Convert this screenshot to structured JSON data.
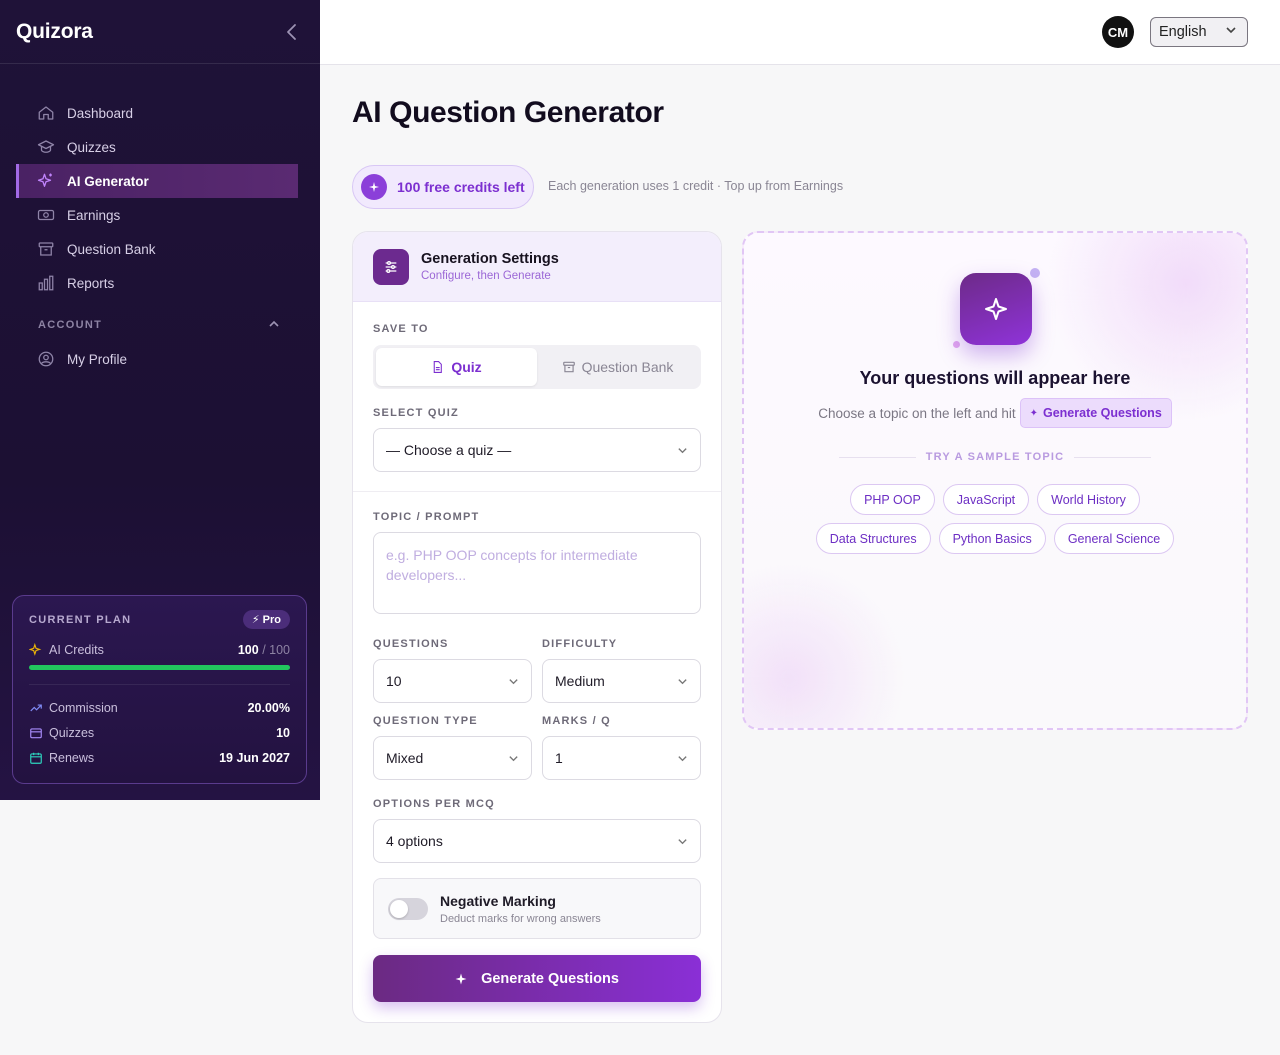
{
  "app": {
    "brand": "Quizora"
  },
  "sidebar": {
    "items": [
      {
        "label": "Dashboard",
        "icon": "home-icon"
      },
      {
        "label": "Quizzes",
        "icon": "graduation-cap-icon"
      },
      {
        "label": "AI Generator",
        "icon": "sparkles-icon",
        "active": true
      },
      {
        "label": "Earnings",
        "icon": "banknote-icon"
      },
      {
        "label": "Question Bank",
        "icon": "archive-icon"
      },
      {
        "label": "Reports",
        "icon": "bar-chart-icon"
      }
    ],
    "account_section": "ACCOUNT",
    "account_items": [
      {
        "label": "My Profile",
        "icon": "user-circle-icon"
      }
    ],
    "plan": {
      "title": "CURRENT PLAN",
      "badge": "Pro",
      "credits_label": "AI Credits",
      "credits_used": "100",
      "credits_total": "/ 100",
      "credits_fraction": 1.0,
      "commission_label": "Commission",
      "commission_value": "20.00%",
      "quizzes_label": "Quizzes",
      "quizzes_value": "10",
      "renews_label": "Renews",
      "renews_value": "19 Jun 2027"
    }
  },
  "topbar": {
    "avatar_initials": "CM",
    "language": "English"
  },
  "main": {
    "title": "AI Question Generator",
    "credits_pill": "100 free credits left",
    "credits_note": "Each generation uses 1 credit · Top up from Earnings"
  },
  "settings": {
    "title": "Generation Settings",
    "subtitle": "Configure, then Generate",
    "save_to_label": "SAVE TO",
    "save_to_options": [
      "Quiz",
      "Question Bank"
    ],
    "select_quiz_label": "SELECT QUIZ",
    "select_quiz_value": "— Choose a quiz —",
    "topic_label": "TOPIC / PROMPT",
    "topic_placeholder": "e.g. PHP OOP concepts for intermediate developers...",
    "questions_label": "QUESTIONS",
    "questions_value": "10",
    "difficulty_label": "DIFFICULTY",
    "difficulty_value": "Medium",
    "question_type_label": "QUESTION TYPE",
    "question_type_value": "Mixed",
    "marks_label": "MARKS / Q",
    "marks_value": "1",
    "options_label": "OPTIONS PER MCQ",
    "options_value": "4 options",
    "negative_title": "Negative Marking",
    "negative_desc": "Deduct marks for wrong answers",
    "negative_on": false,
    "generate_label": "Generate Questions"
  },
  "empty_state": {
    "title": "Your questions will appear here",
    "subtitle": "Choose a topic on the left and hit",
    "chip_label": "Generate Questions",
    "try_label": "TRY A SAMPLE TOPIC",
    "topics_row1": [
      "PHP OOP",
      "JavaScript",
      "World History"
    ],
    "topics_row2": [
      "Data Structures",
      "Python Basics",
      "General Science"
    ]
  },
  "colors": {
    "accent": "#7c2fd0",
    "sidebar_bg": "#1f1238",
    "progress": "#22c55e"
  }
}
